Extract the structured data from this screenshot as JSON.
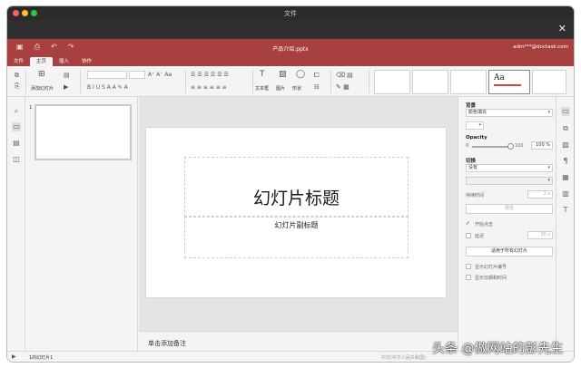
{
  "window": {
    "title": "文件",
    "colors": {
      "header": "#a84040",
      "titlebar": "#2b2b2b"
    }
  },
  "app": {
    "document_title": "产品介绍.pptx",
    "user": "adm***@doctask.com",
    "tabs": [
      {
        "label": "文件",
        "active": false
      },
      {
        "label": "主页",
        "active": true
      },
      {
        "label": "插入",
        "active": false
      },
      {
        "label": "协作",
        "active": false
      }
    ]
  },
  "toolbar": {
    "add_slide": "添加幻灯片",
    "textbox": "文本框",
    "image": "图片",
    "shape": "形状",
    "layout_preview": "Aa"
  },
  "slides": {
    "thumbnail_number": "1"
  },
  "slide": {
    "title": "幻灯片标题",
    "subtitle": "幻灯片副标题"
  },
  "notes": {
    "placeholder": "单击添加备注"
  },
  "right_panel": {
    "background_heading": "背景",
    "fill_value": "颜色填充",
    "opacity_heading": "Opacity",
    "opacity_min": "0",
    "opacity_max": "100",
    "opacity_value": "100 %",
    "transition_heading": "切换",
    "transition_value": "没有",
    "duration_label": "持续时间",
    "duration_value": "2 s",
    "preview_button": "预览",
    "start_on_click": "开始点击",
    "delay_label": "延迟",
    "delay_value": "10 s",
    "apply_all_button": "适用于所有幻灯片",
    "show_slide_number": "显示幻灯片编号",
    "show_date_time": "显示日期和时间"
  },
  "status": {
    "slide_counter": "1的幻灯片1",
    "language": "中文(中华人民共和国)"
  },
  "watermark": "头条 @做网站的彭先生"
}
